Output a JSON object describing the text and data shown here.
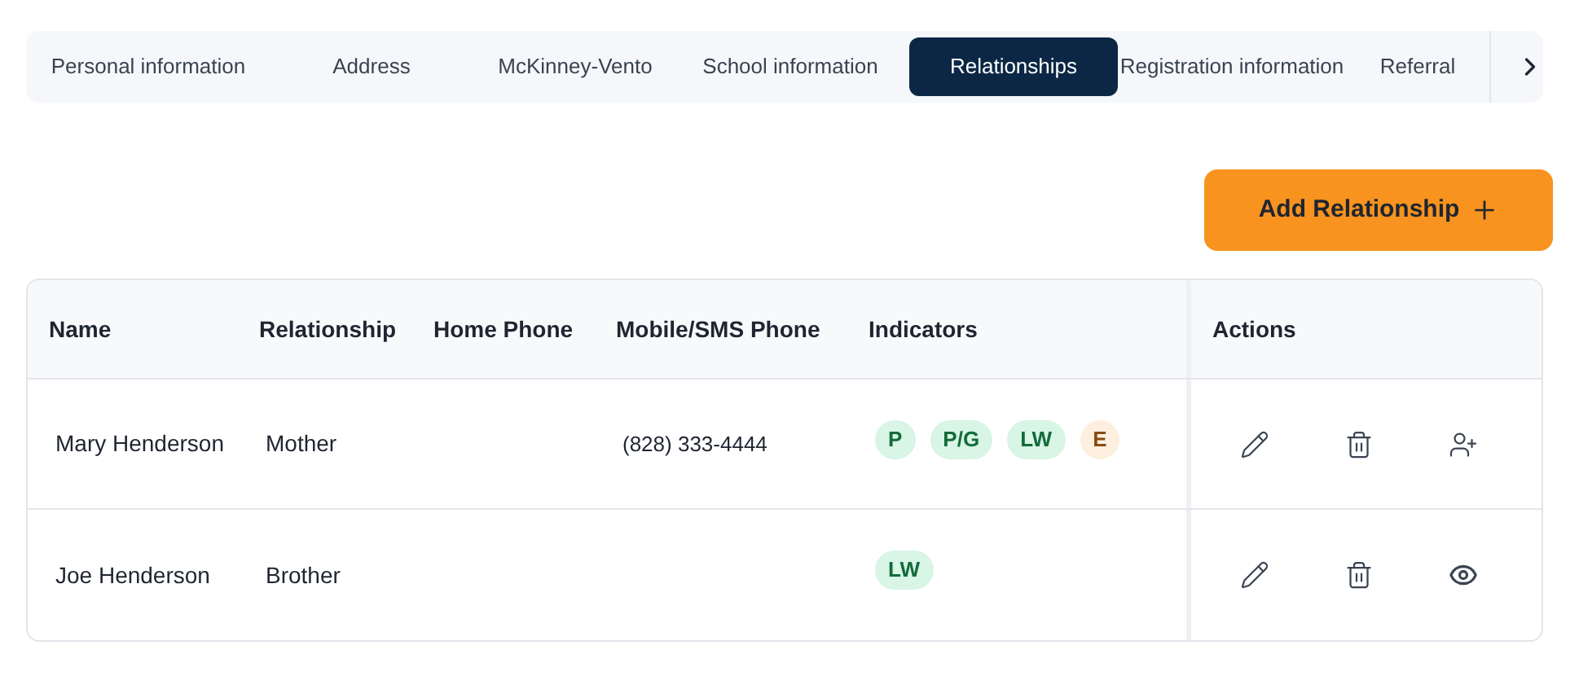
{
  "tabs": [
    {
      "label": "Personal information",
      "selected": false
    },
    {
      "label": "Address",
      "selected": false
    },
    {
      "label": "McKinney-Vento",
      "selected": false
    },
    {
      "label": "School information",
      "selected": false
    },
    {
      "label": "Relationships",
      "selected": true
    },
    {
      "label": "Registration information",
      "selected": false
    },
    {
      "label": "Referral",
      "selected": false
    }
  ],
  "add_button": {
    "label": "Add Relationship"
  },
  "table": {
    "columns": [
      "Name",
      "Relationship",
      "Home Phone",
      "Mobile/SMS Phone",
      "Indicators",
      "Actions"
    ],
    "rows": [
      {
        "name": "Mary Henderson",
        "relationship": "Mother",
        "mobile_phone": "(828) 333-4444",
        "indicators": [
          {
            "label": "P",
            "kind": "standard",
            "color": "#d8f5e6"
          },
          {
            "label": "P/G",
            "kind": "standard",
            "color": "#d8f5e6"
          },
          {
            "label": "LW",
            "kind": "standard",
            "color": "#d8f5e6"
          },
          {
            "label": "E",
            "kind": "emergency",
            "color": "#fdefe0"
          }
        ],
        "actions": [
          {
            "kind": "edit"
          },
          {
            "kind": "delete"
          },
          {
            "kind": "add-user"
          }
        ]
      },
      {
        "name": "Joe Henderson",
        "relationship": "Brother",
        "mobile_phone": "",
        "indicators": [
          {
            "label": "LW",
            "kind": "standard",
            "color": "#d8f5e6"
          }
        ],
        "actions": [
          {
            "kind": "edit"
          },
          {
            "kind": "delete"
          },
          {
            "kind": "view"
          }
        ]
      }
    ]
  }
}
